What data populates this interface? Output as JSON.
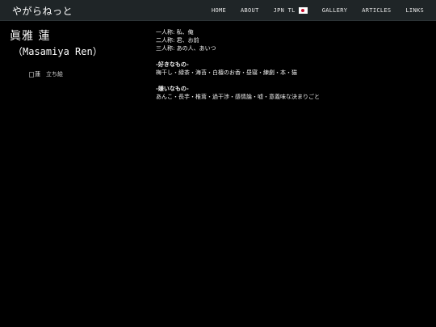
{
  "header": {
    "site_title": "やがらねっと",
    "nav": [
      {
        "label": "HOME"
      },
      {
        "label": "ABOUT"
      },
      {
        "label": "JPN TL",
        "icon": "japan-flag-icon"
      },
      {
        "label": "GALLERY"
      },
      {
        "label": "ARTICLES"
      },
      {
        "label": "LINKS"
      }
    ]
  },
  "profile": {
    "name_jp": "眞雅 蓮",
    "name_en": "（Masamiya Ren）",
    "image_alt": "蓮　立ち絵"
  },
  "pronouns": {
    "first": "一人称: 私、俺",
    "second": "二人称: 君、お前",
    "third": "三人称: あの人、あいつ"
  },
  "likes": {
    "heading": "-好きなもの-",
    "items": "梅干し・緑茶・海苔・白檀のお香・昼寝・練劇・本・猫"
  },
  "dislikes": {
    "heading": "-嫌いなもの-",
    "items": "あんこ・長芋・椎茸・過干渉・感情論・嘘・意義味な決まりごと"
  },
  "colors": {
    "topbar_bg": "#1f2527",
    "page_bg": "#000000",
    "flag_red": "#c8102e"
  }
}
